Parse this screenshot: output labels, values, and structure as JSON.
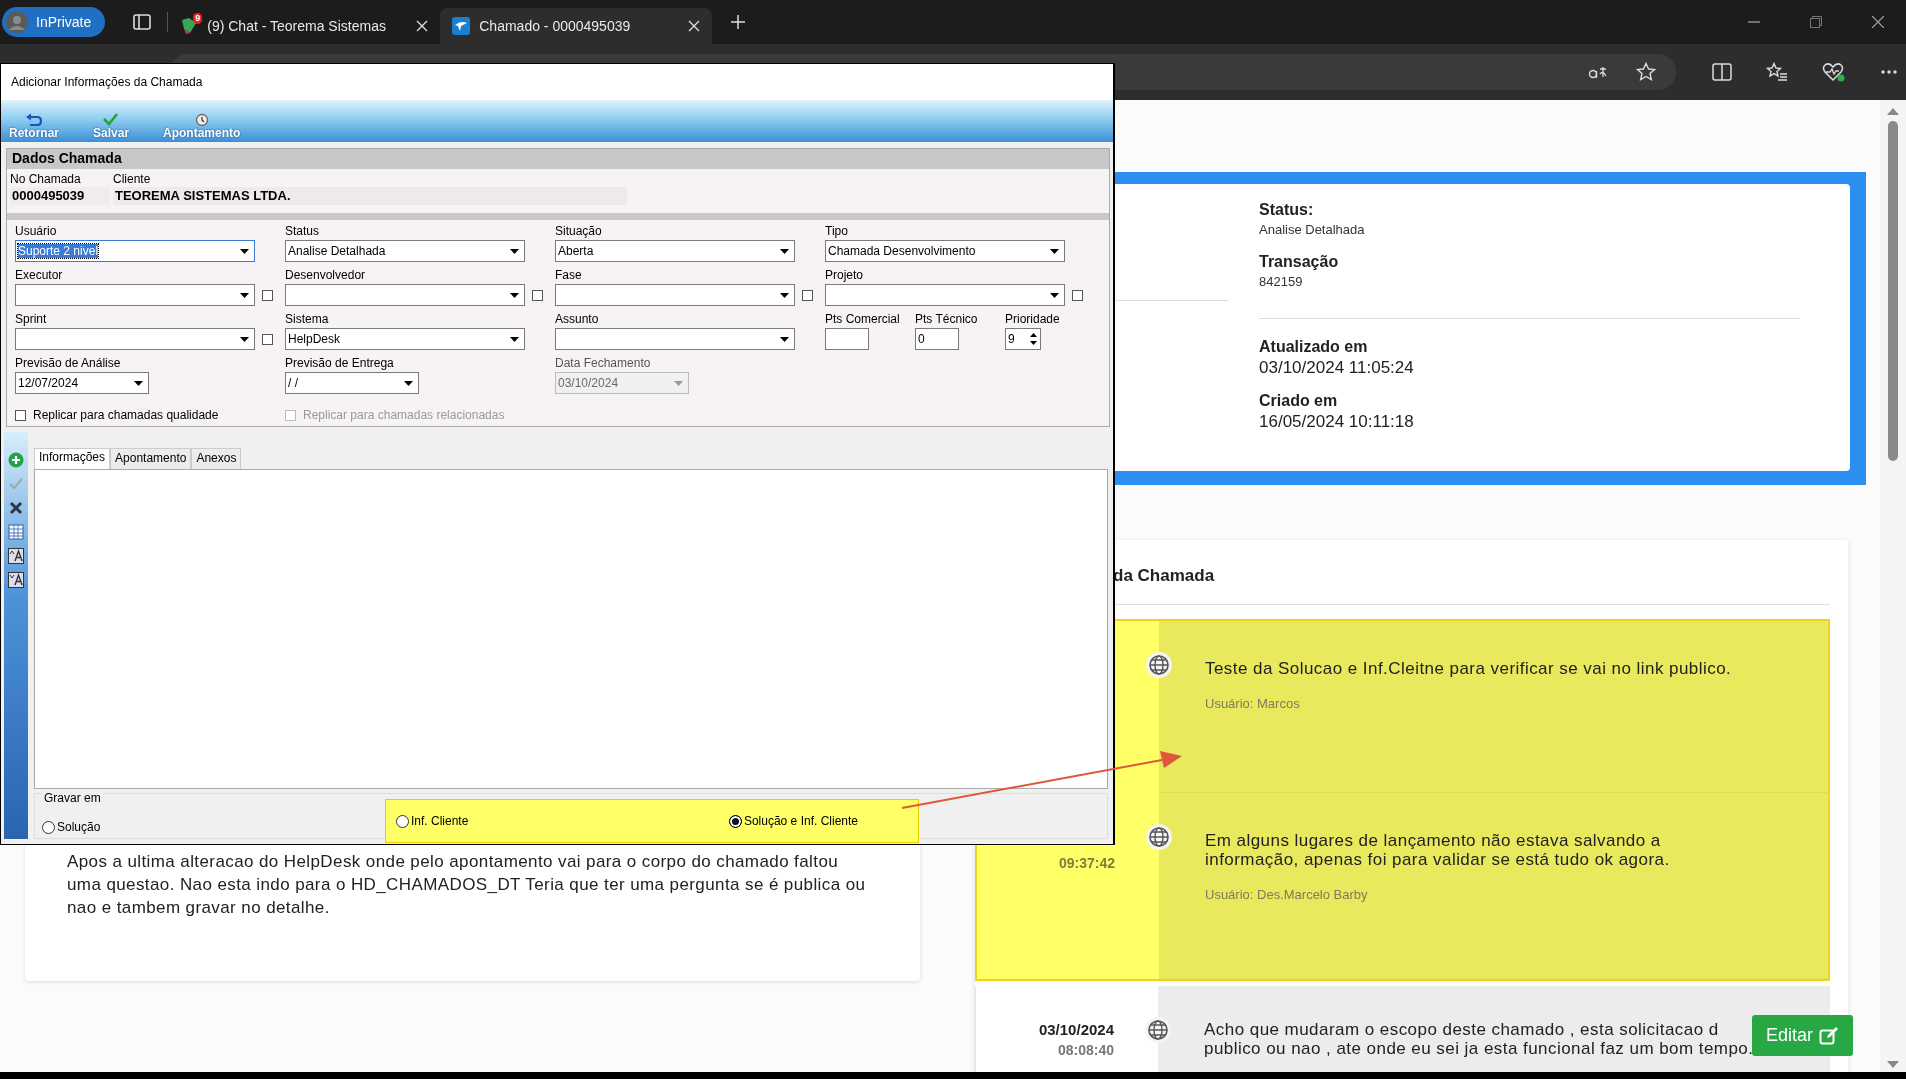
{
  "browser": {
    "profile": "InPrivate",
    "tabs": [
      {
        "title": "(9) Chat - Teorema Sistemas",
        "badge": "9",
        "selected": false
      },
      {
        "title": "Chamado - 0000495039",
        "selected": true
      }
    ]
  },
  "page": {
    "status_card": {
      "items": [
        {
          "kind": "detail",
          "label": "Status:",
          "value": "Analise Detalhada"
        },
        {
          "kind": "detail",
          "label": "Transação",
          "value": "842159"
        },
        {
          "kind": "timestamp",
          "label": "Atualizado em",
          "value": "03/10/2024 11:05:24"
        },
        {
          "kind": "timestamp",
          "label": "Criado em",
          "value": "16/05/2024 10:11:18"
        }
      ]
    },
    "description": "Apos a ultima alteracao do HelpDesk onde pelo apontamento vai para o corpo do chamado faltou uma questao. Nao esta indo para o HD_CHAMADOS_DT Teria que ter uma pergunta se é publica ou nao e tambem gravar no detalhe.",
    "history": {
      "title": "da Chamada",
      "entries": [
        {
          "lines": [
            "Teste da Solucao e Inf.Cleitne para verificar se vai no link publico."
          ],
          "user": "Usuário: Marcos",
          "highlighted": true
        },
        {
          "time": "09:37:42",
          "lines": [
            "Em alguns lugares de lançamento não estava salvando a",
            "informação, apenas foi para validar se está tudo ok agora."
          ],
          "user": "Usuário: Des.Marcelo Barby",
          "highlighted": true
        },
        {
          "date": "03/10/2024",
          "time": "08:08:40",
          "lines": [
            "Acho que mudaram o escopo deste chamado , esta solicitacao d",
            "publico ou nao , ate onde eu sei ja esta funcional faz um bom tempo."
          ],
          "highlighted": false
        }
      ]
    },
    "edit_button": "Editar"
  },
  "dialog": {
    "title": "Adicionar Informações da Chamada",
    "toolbar": [
      {
        "kind": "back",
        "label": "Retornar"
      },
      {
        "kind": "check",
        "label": "Salvar"
      },
      {
        "kind": "clock",
        "label": "Apontamento"
      }
    ],
    "section": "Dados Chamada",
    "header_fields": [
      {
        "label": "No Chamada",
        "value": "0000495039"
      },
      {
        "label": "Cliente",
        "value": "TEOREMA SISTEMAS LTDA."
      }
    ],
    "form_rows": [
      [
        {
          "label": "Usuário",
          "kind": "combo",
          "value": "Suporte 2 nivel",
          "focused": true,
          "disabled": false
        },
        {
          "label": "Status",
          "kind": "combo",
          "value": "Analise Detalhada",
          "focused": false,
          "disabled": false
        },
        {
          "label": "Situação",
          "kind": "combo",
          "value": "Aberta",
          "focused": false,
          "disabled": false
        },
        {
          "label": "Tipo",
          "kind": "combo",
          "value": "Chamada Desenvolvimento",
          "focused": false,
          "disabled": false
        }
      ],
      [
        {
          "label": "Executor",
          "kind": "combo",
          "focused": false,
          "disabled": false,
          "flag": {
            "checked": false
          }
        },
        {
          "label": "Desenvolvedor",
          "kind": "combo",
          "focused": false,
          "disabled": false,
          "flag": {
            "checked": false
          }
        },
        {
          "label": "Fase",
          "kind": "combo",
          "focused": false,
          "disabled": false,
          "flag": {
            "checked": false
          }
        },
        {
          "label": "Projeto",
          "kind": "combo",
          "focused": false,
          "disabled": false,
          "flag": {
            "checked": false
          }
        }
      ],
      [
        {
          "label": "Sprint",
          "kind": "combo",
          "focused": false,
          "disabled": false,
          "flag": {
            "checked": false
          }
        },
        {
          "label": "Sistema",
          "kind": "combo",
          "value": "HelpDesk",
          "focused": false,
          "disabled": false
        },
        {
          "label": "Assunto",
          "kind": "combo",
          "focused": false,
          "disabled": false
        },
        {
          "label": "Pts Comercial",
          "kind": "text",
          "focused": false,
          "disabled": false
        },
        {
          "label": "Pts Técnico",
          "kind": "text",
          "value": "0",
          "focused": false,
          "disabled": false
        },
        {
          "label": "Prioridade",
          "kind": "spin",
          "value": "9",
          "focused": false,
          "disabled": false
        }
      ],
      [
        {
          "label": "Previsão de Análise",
          "kind": "date",
          "value": "12/07/2024",
          "focused": false,
          "disabled": false
        },
        {
          "label": "Previsão de Entrega",
          "kind": "date",
          "value": "/ /",
          "focused": false,
          "disabled": false
        },
        {
          "label": "Data Fechamento",
          "kind": "date",
          "value": "03/10/2024",
          "focused": false,
          "disabled": true
        }
      ]
    ],
    "options": [
      {
        "label": "Replicar para chamadas qualidade",
        "checked": false,
        "disabled": false
      },
      {
        "label": "Replicar para chamadas relacionadas",
        "checked": false,
        "disabled": true
      }
    ],
    "side_tools": [
      {
        "kind": "add",
        "disabled": false
      },
      {
        "kind": "confirm",
        "disabled": true
      },
      {
        "kind": "delete",
        "disabled": false
      },
      {
        "kind": "grid",
        "disabled": false
      },
      {
        "kind": "font-up",
        "disabled": false
      },
      {
        "kind": "font-down",
        "disabled": false
      }
    ],
    "tabs": [
      {
        "label": "Informações",
        "selected": true
      },
      {
        "label": "Apontamento",
        "selected": false
      },
      {
        "label": "Anexos",
        "selected": false
      }
    ],
    "save_to": {
      "legend": "Gravar em",
      "options": [
        {
          "label": "Solução",
          "selected": false,
          "highlighted": false
        },
        {
          "label": "Inf. Cliente",
          "selected": false,
          "highlighted": true
        },
        {
          "label": "Solução e Inf. Cliente",
          "selected": true,
          "highlighted": true
        }
      ]
    }
  },
  "annotation_arrow": true
}
